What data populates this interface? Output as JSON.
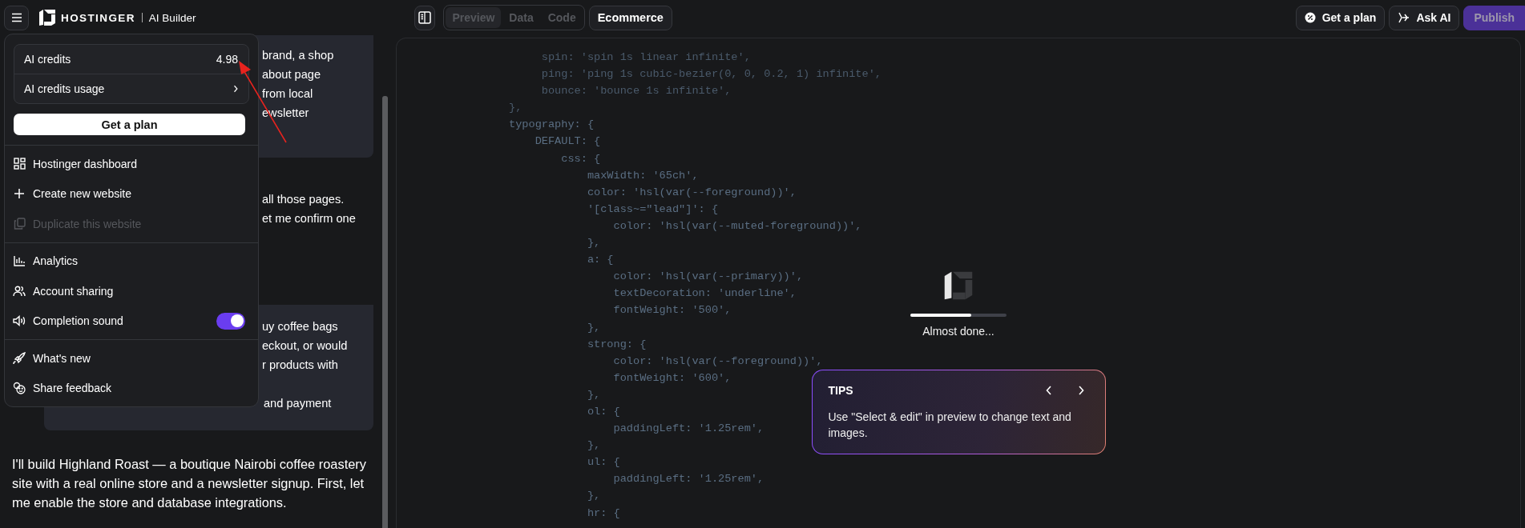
{
  "topbar": {
    "brand": "HOSTINGER",
    "product": "AI Builder",
    "view_tabs": [
      {
        "label": "Preview",
        "selected": true
      },
      {
        "label": "Data",
        "selected": false
      },
      {
        "label": "Code",
        "selected": false
      }
    ],
    "project": "Ecommerce",
    "actions": [
      {
        "label": "Get a plan",
        "kind": "plan"
      },
      {
        "label": "Ask AI",
        "kind": "ai"
      },
      {
        "label": "Publish",
        "kind": "publish"
      }
    ]
  },
  "chat": {
    "blocks": [
      {
        "kind": "user",
        "lines": [
          "brand, a shop",
          "about page",
          "from local",
          "ewsletter"
        ]
      },
      {
        "kind": "assistant",
        "lines": [
          "all those pages.",
          "et me confirm one"
        ]
      },
      {
        "kind": "user",
        "lines": [
          "uy coffee bags",
          "eckout, or would",
          "r products with"
        ],
        "tail": "and payment"
      },
      {
        "kind": "message",
        "lines": [
          "I'll build Highland Roast — a boutique Nairobi coffee roastery site with a real online store and a newsletter signup. First, let me enable the store and database integrations."
        ]
      }
    ]
  },
  "menu": {
    "credits_label": "AI credits",
    "credits_value": "4.98",
    "usage_label": "AI credits usage",
    "plan_button": "Get a plan",
    "groups": [
      [
        {
          "label": "Hostinger dashboard",
          "kind": "link",
          "disabled": false
        },
        {
          "label": "Create new website",
          "kind": "link",
          "disabled": false
        },
        {
          "label": "Duplicate this website",
          "kind": "link",
          "disabled": true
        }
      ],
      [
        {
          "label": "Analytics",
          "kind": "link",
          "disabled": false
        },
        {
          "label": "Account sharing",
          "kind": "link",
          "disabled": false
        },
        {
          "label": "Completion sound",
          "kind": "toggle",
          "disabled": false,
          "on": true
        }
      ],
      [
        {
          "label": "What's new",
          "kind": "link",
          "disabled": false
        },
        {
          "label": "Share feedback",
          "kind": "link",
          "disabled": false
        }
      ]
    ]
  },
  "code": {
    "lines": [
      "     spin: 'spin 1s linear infinite',",
      "     ping: 'ping 1s cubic-bezier(0, 0, 0.2, 1) infinite',",
      "     bounce: 'bounce 1s infinite',",
      "},",
      "typography: {",
      "    DEFAULT: {",
      "        css: {",
      "            maxWidth: '65ch',",
      "            color: 'hsl(var(--foreground))',",
      "            '[class~=\"lead\"]': {",
      "                color: 'hsl(var(--muted-foreground))',",
      "            },",
      "            a: {",
      "                color: 'hsl(var(--primary))',",
      "                textDecoration: 'underline',",
      "                fontWeight: '500',",
      "            },",
      "            strong: {",
      "                color: 'hsl(var(--foreground))',",
      "                fontWeight: '600',",
      "            },",
      "            ol: {",
      "                paddingLeft: '1.25rem',",
      "            },",
      "            ul: {",
      "                paddingLeft: '1.25rem',",
      "            },",
      "            hr: {"
    ]
  },
  "loader": {
    "level": 0.63,
    "status": "Almost done..."
  },
  "tips": {
    "title": "TIPS",
    "text": "Use \"Select & edit\" in preview to change text and images."
  }
}
